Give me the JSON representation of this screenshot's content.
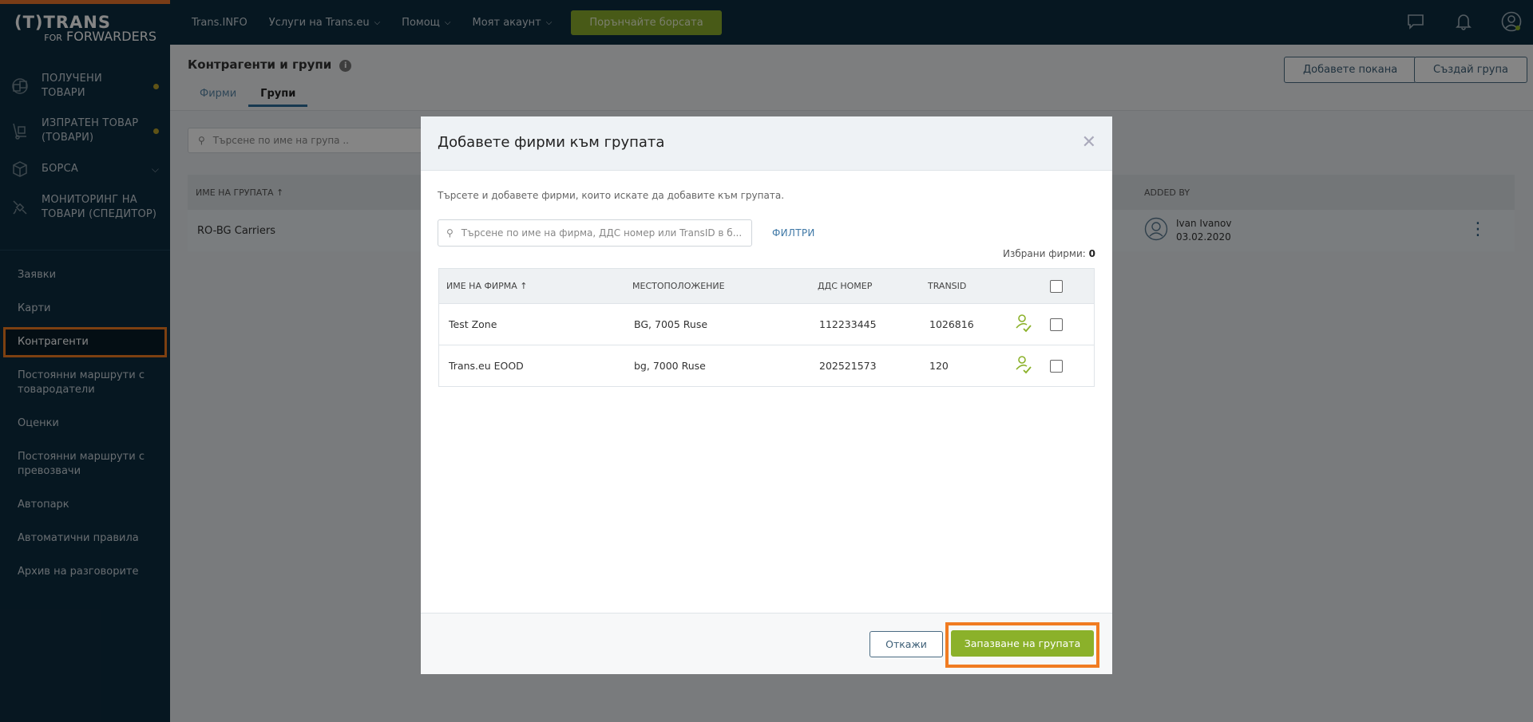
{
  "logo": {
    "line1": "(T)TRANS",
    "line2_small": "FOR",
    "line2": "FORWARDERS"
  },
  "sidebar": {
    "main_items": [
      {
        "label": "ПОЛУЧЕНИ\nТОВАРИ",
        "icon": "boxes-icon"
      },
      {
        "label": "ИЗПРАТЕН ТОВАР\n(ТОВАРИ)",
        "icon": "dolly-icon"
      },
      {
        "label": "БОРСА",
        "icon": "cube-icon"
      },
      {
        "label": "МОНИТОРИНГ НА\nТОВАРИ (СПЕДИТОР)",
        "icon": "satellite-icon"
      }
    ],
    "sub_items": [
      {
        "label": "Заявки"
      },
      {
        "label": "Карти"
      },
      {
        "label": "Контрагенти"
      },
      {
        "label": "Постоянни маршрути с товародатели"
      },
      {
        "label": "Оценки"
      },
      {
        "label": "Постоянни маршрути с превозвачи"
      },
      {
        "label": "Автопарк"
      },
      {
        "label": "Автоматични правила"
      },
      {
        "label": "Архив на разговорите"
      }
    ]
  },
  "topbar": {
    "links": [
      "Trans.INFO",
      "Услуги на Trans.eu",
      "Помощ",
      "Моят акаунт"
    ],
    "cta": "Порънчайте борсата"
  },
  "page": {
    "title": "Контрагенти и групи",
    "tabs": [
      "Фирми",
      "Групи"
    ],
    "invite_button": "Добавете покана",
    "create_group_button": "Създай група",
    "search_placeholder": "Търсене по име на група ..",
    "table_header": {
      "group_name": "ИМЕ НА ГРУПАТА ↑",
      "added_by": "ADDED BY"
    },
    "row": {
      "group_name": "RO-BG Carriers",
      "added_by_name": "Ivan Ivanov",
      "added_by_date": "03.02.2020"
    }
  },
  "modal": {
    "title": "Добавете фирми към групата",
    "description": "Търсете и добавете фирми, които искате да добавите към групата.",
    "search_placeholder": "Търсене по име на фирма, ДДС номер или TransID в б...",
    "filters": "ФИЛТРИ",
    "selected_label": "Избрани фирми:",
    "selected_count": "0",
    "columns": [
      "ИМЕ НА ФИРМА ↑",
      "МЕСТОПОЛОЖЕНИЕ",
      "ДДС НОМЕР",
      "TRANSID"
    ],
    "rows": [
      {
        "name": "Test Zone",
        "location": "BG, 7005 Ruse",
        "vat": "112233445",
        "transid": "1026816"
      },
      {
        "name": "Trans.eu EOOD",
        "location": "bg, 7000 Ruse",
        "vat": "202521573",
        "transid": "120"
      }
    ],
    "cancel": "Откажи",
    "save": "Запазване на групата"
  },
  "colors": {
    "accent_orange": "#f07c22",
    "green": "#8bb12a",
    "navy": "#0d2d40"
  }
}
